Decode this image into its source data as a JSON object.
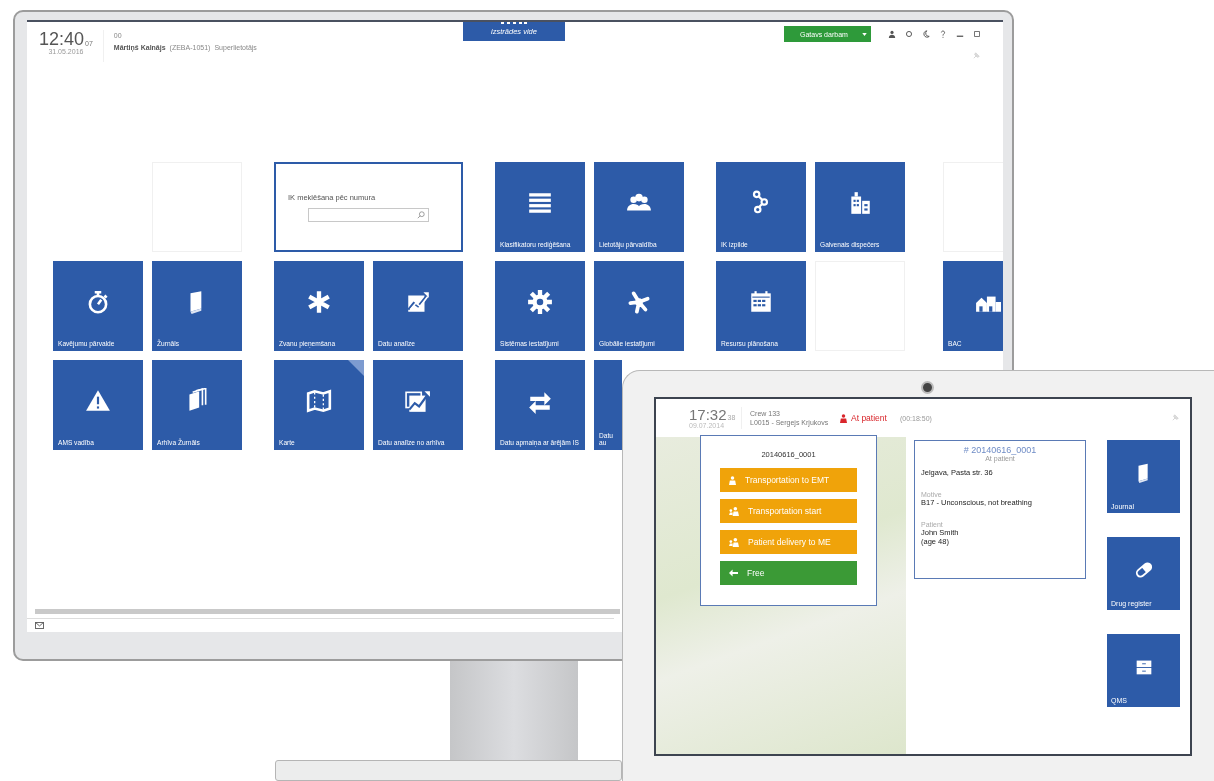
{
  "desktop": {
    "header": {
      "time": "12:40",
      "seconds": "07",
      "date": "31.05.2016",
      "shift": "00",
      "user_name": "Mārtiņš Kalnājs",
      "user_code": "(ZEBA-1051)",
      "user_role": "Superlietotājs",
      "environment": "izstrādes vide",
      "status_button": "Gatavs darbam"
    },
    "tile_rows": [
      [
        {
          "kind": "empty"
        },
        {
          "kind": "blank"
        },
        {
          "kind": "search",
          "label": "IK meklēšana pēc numura"
        },
        {
          "kind": "tile",
          "label": "Klasifikatoru rediģēšana",
          "flagged": false
        },
        {
          "kind": "tile",
          "label": "Lietotāju pārvaldība",
          "flagged": false
        },
        {
          "kind": "tile",
          "label": "IK izpilde",
          "flagged": false
        },
        {
          "kind": "tile",
          "label": "Galvenais dispečers",
          "flagged": false
        },
        {
          "kind": "blank"
        }
      ],
      [
        {
          "kind": "tile",
          "label": "Kavējumu pārvalde",
          "flagged": false
        },
        {
          "kind": "tile",
          "label": "Žurnāls",
          "flagged": false
        },
        {
          "kind": "tile",
          "label": "Zvanu pieņemšana",
          "flagged": false
        },
        {
          "kind": "tile",
          "label": "Datu analīze",
          "flagged": false
        },
        {
          "kind": "tile",
          "label": "Sistēmas iestatījumi",
          "flagged": false
        },
        {
          "kind": "tile",
          "label": "Globālie iestatījumi",
          "flagged": false
        },
        {
          "kind": "tile",
          "label": "Resursu plānošana",
          "flagged": false
        },
        {
          "kind": "blank"
        },
        {
          "kind": "tile",
          "label": "BAC",
          "flagged": false
        }
      ],
      [
        {
          "kind": "tile",
          "label": "AMS vadība",
          "flagged": false
        },
        {
          "kind": "tile",
          "label": "Arhīva Žurnāls",
          "flagged": false
        },
        {
          "kind": "tile",
          "label": "Karte",
          "flagged": true
        },
        {
          "kind": "tile",
          "label": "Datu analīze no arhīva",
          "flagged": false
        },
        {
          "kind": "tile",
          "label": "Datu apmaiņa ar ārējām IS",
          "flagged": false
        },
        {
          "kind": "tile",
          "label": "Datu au",
          "flagged": false
        }
      ]
    ]
  },
  "tablet": {
    "header": {
      "time": "17:32",
      "seconds": "38",
      "date": "09.07.2014",
      "crew": "Crew 133",
      "member": "L0015 - Sergejs Krjukovs",
      "status": "At patient",
      "timer": "(00:18:50)"
    },
    "call_card": {
      "number": "20140616_0001",
      "actions": [
        {
          "kind": "status",
          "label": "Transportation to EMT"
        },
        {
          "kind": "status",
          "label": "Transportation start"
        },
        {
          "kind": "status",
          "label": "Patient delivery to ME"
        },
        {
          "kind": "back",
          "label": "Free"
        }
      ]
    },
    "incident": {
      "number": "# 20140616_0001",
      "status": "At patient",
      "address": "Jelgava, Pasta str. 36",
      "fields": [
        {
          "label": "Motive",
          "lines": [
            "B17 - Unconscious, not breathing"
          ]
        },
        {
          "label": "Patient",
          "lines": [
            "John Smith",
            "(age 48)"
          ]
        }
      ]
    },
    "tiles": [
      {
        "label": "Journal"
      },
      {
        "label": "Drug register"
      },
      {
        "label": "QMS"
      }
    ]
  }
}
